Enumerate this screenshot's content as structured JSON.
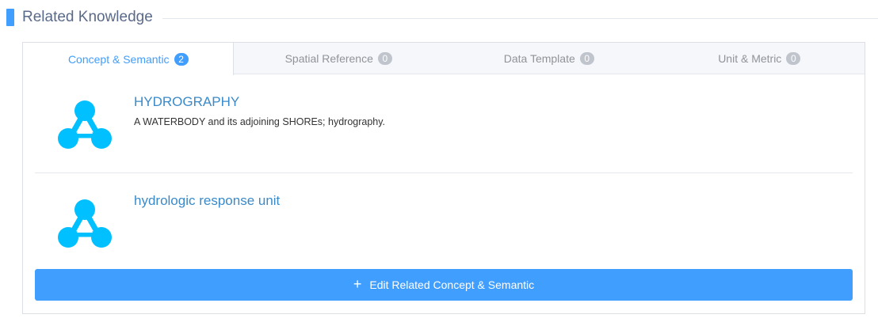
{
  "section": {
    "title": "Related Knowledge"
  },
  "tabs": [
    {
      "label": "Concept & Semantic",
      "count": "2",
      "active": true
    },
    {
      "label": "Spatial Reference",
      "count": "0",
      "active": false
    },
    {
      "label": "Data Template",
      "count": "0",
      "active": false
    },
    {
      "label": "Unit & Metric",
      "count": "0",
      "active": false
    }
  ],
  "concepts": [
    {
      "icon": "concept-node-icon",
      "title": "HYDROGRAPHY",
      "description": "A WATERBODY and its adjoining SHOREs; hydrography."
    },
    {
      "icon": "concept-node-icon",
      "title": "hydrologic response unit",
      "description": ""
    }
  ],
  "edit_button": {
    "icon": "plus-icon",
    "label": "Edit Related Concept & Semantic"
  },
  "colors": {
    "accent": "#409eff",
    "icon": "#00c0ff",
    "title_text": "#3a8ac9"
  }
}
